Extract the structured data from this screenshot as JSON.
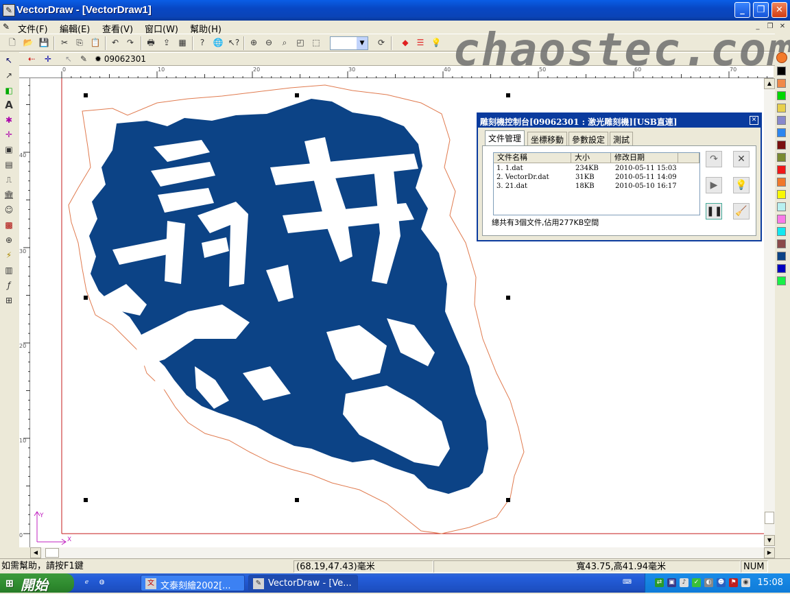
{
  "window": {
    "title": "VectorDraw - [VectorDraw1]"
  },
  "menu": {
    "items": [
      "文件(F)",
      "編輯(E)",
      "查看(V)",
      "窗口(W)",
      "幫助(H)"
    ]
  },
  "toolbar2": {
    "label": "09062301"
  },
  "watermark": "chaostec.com",
  "ruler": {
    "h_labels": [
      "0",
      "10",
      "20",
      "30",
      "40",
      "50",
      "60",
      "70"
    ],
    "v_labels": [
      "40",
      "30",
      "20",
      "10",
      "0"
    ]
  },
  "canvas": {
    "axis_y": "Y",
    "axis_x": "X",
    "artwork_color": "#0c4386",
    "outline_color": "#e07a4e"
  },
  "panel": {
    "title": "雕刻機控制台[09062301 : 激光雕刻機][USB直連]",
    "tabs": [
      "文件管理",
      "坐標移動",
      "參數設定",
      "測試"
    ],
    "columns": [
      "文件名稱",
      "大小",
      "修改日期"
    ],
    "files": [
      {
        "name": "1. 1.dat",
        "size": "234KB",
        "date": "2010-05-11 15:03"
      },
      {
        "name": "2. VectorDr.dat",
        "size": "31KB",
        "date": "2010-05-11 14:09"
      },
      {
        "name": "3. 21.dat",
        "size": "18KB",
        "date": "2010-05-10 16:17"
      }
    ],
    "summary": "總共有3個文件,佔用277KB空間"
  },
  "palette": [
    "#f37a2b",
    "#000000",
    "#f0894a",
    "#00d800",
    "#e8d04c",
    "#8888cc",
    "#2d86ef",
    "#7a1010",
    "#7a8a30",
    "#f01818",
    "#f0782a",
    "#f8f800",
    "#b8f0f0",
    "#f87ae8",
    "#12e8f0",
    "#8a4a4a",
    "#0c4386",
    "#0000c0",
    "#18f048"
  ],
  "status": {
    "help": "如需幫助，請按F1鍵",
    "coords": "(68.19,47.43)毫米",
    "size": "寬43.75,高41.94毫米",
    "num": "NUM"
  },
  "taskbar": {
    "start": "開始",
    "tasks": [
      "文泰刻繪2002[...",
      "VectorDraw - [Ve..."
    ],
    "time": "15:08"
  }
}
